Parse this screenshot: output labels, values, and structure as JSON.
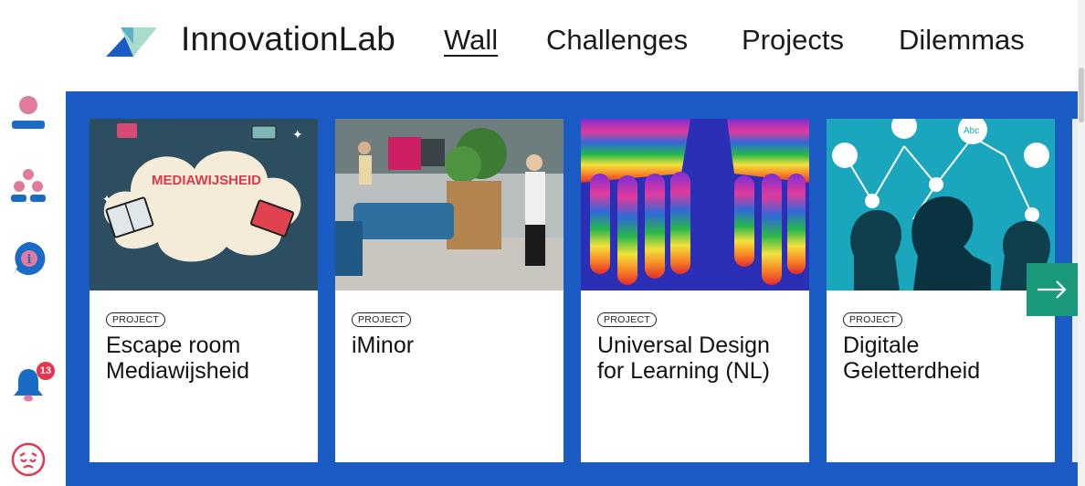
{
  "header": {
    "brand": "InnovationLab",
    "nav": [
      "Wall",
      "Challenges",
      "Projects",
      "Dilemmas"
    ],
    "active_nav": "Wall"
  },
  "sidebar": {
    "items": [
      {
        "icon": "user-icon"
      },
      {
        "icon": "group-icon"
      },
      {
        "icon": "info-icon"
      },
      {
        "icon": "bell-icon",
        "badge": "13"
      },
      {
        "icon": "feedback-face-icon"
      }
    ]
  },
  "cards": [
    {
      "tag": "PROJECT",
      "title": "Escape room Mediawijsheid",
      "image_text": "MEDIAWIJSHEID"
    },
    {
      "tag": "PROJECT",
      "title": "iMinor"
    },
    {
      "tag": "PROJECT",
      "title": "Universal Design for Learning (NL)"
    },
    {
      "tag": "PROJECT",
      "title": "Digitale Geletterdheid",
      "image_text": "Abc"
    }
  ],
  "colors": {
    "wall_background": "#1a5cc4",
    "next_button": "#1a9a7a",
    "sidebar_icons": "#1a6bc6",
    "badge": "#e8344e"
  }
}
